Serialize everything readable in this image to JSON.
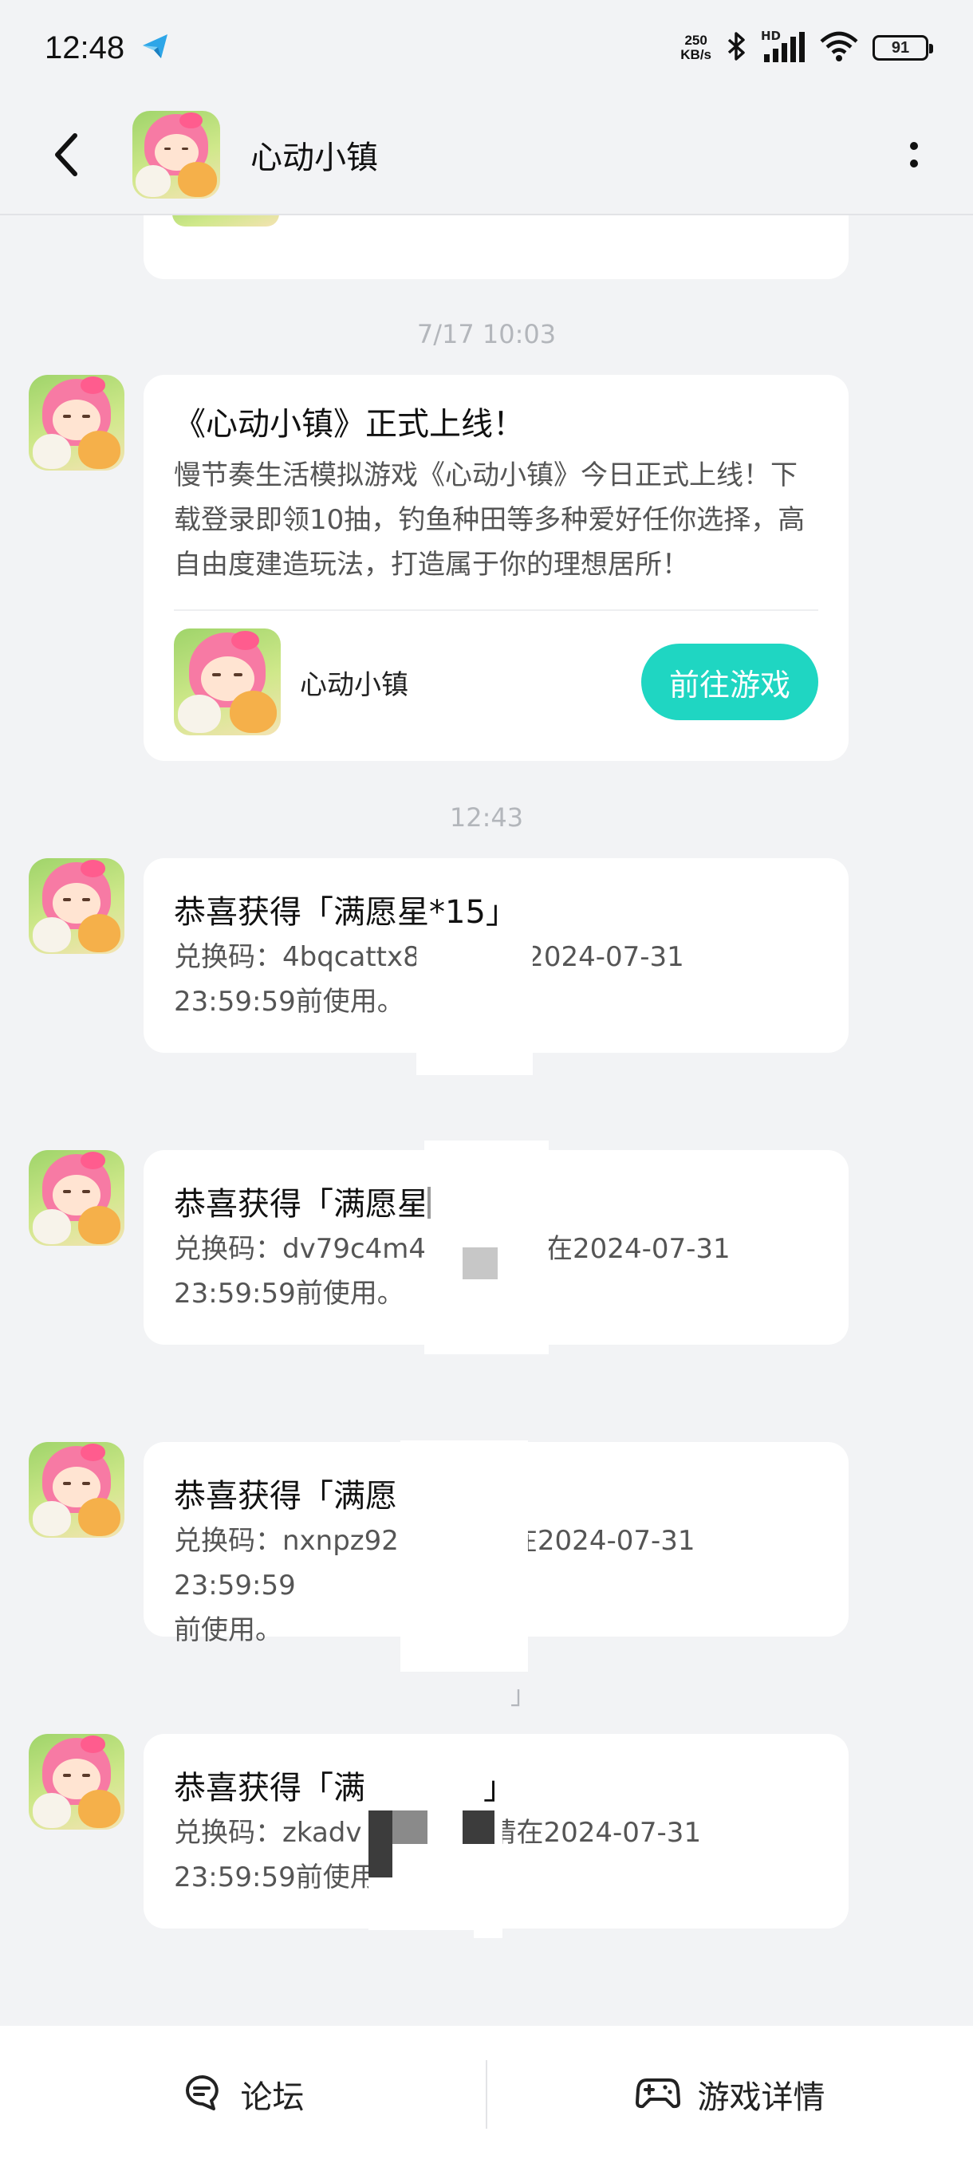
{
  "status_bar": {
    "time": "12:48",
    "net_speed_value": "250",
    "net_speed_unit": "KB/s",
    "network_label": "HD",
    "battery_level": "91",
    "icons": [
      "telegram-icon",
      "bluetooth-icon",
      "signal-icon",
      "wifi-icon",
      "battery-icon"
    ]
  },
  "nav": {
    "title": "心动小镇",
    "icons": [
      "back-icon",
      "app-avatar",
      "more-icon"
    ]
  },
  "messages": [
    {
      "time": "7/17  10:03",
      "title": "《心动小镇》正式上线！",
      "body": "慢节奏生活模拟游戏《心动小镇》今日正式上线！下载登录即领10抽，钓鱼种田等多种爱好任你选择，高自由度建造玩法，打造属于你的理想居所！",
      "card_name": "心动小镇",
      "card_button": "前往游戏"
    },
    {
      "time": "12:43",
      "title": "恭喜获得「满愿星*15」",
      "code_line1": "兑换码：4bqcattx8j",
      "code_line1_tail": "在2024-07-31",
      "code_line2": "23:59:59前使用。"
    },
    {
      "title": "恭喜获得「满愿星",
      "code_line1": "兑换码：dv79c4m4",
      "code_line1_tail": "在2024-07-31",
      "code_line2": "23:59:59前使用。"
    },
    {
      "title": "恭喜获得「满愿",
      "code_line1": "兑换码：nxnpz92",
      "code_line1_tail": "在2024-07-31 23:59:59",
      "code_line2": "前使用。"
    },
    {
      "time_fragment": "」",
      "title": "恭喜获得「满",
      "title_tail": "」",
      "code_line1": "兑换码：zkadv",
      "code_line1_tail": "请在2024-07-31",
      "code_line2": "23:59:59前使用"
    }
  ],
  "bottom_bar": {
    "forum_label": "论坛",
    "details_label": "游戏详情",
    "icons": [
      "forum-icon",
      "gamepad-icon"
    ]
  },
  "colors": {
    "accent": "#1fd6c2",
    "background": "#f2f3f5",
    "card": "#ffffff",
    "timestamp": "#b3b6bb"
  }
}
